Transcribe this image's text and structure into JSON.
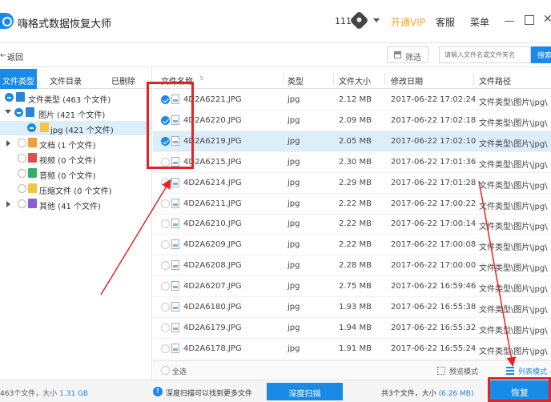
{
  "app": {
    "title": "嗨格式数据恢复大师",
    "user_number": "111"
  },
  "header": {
    "vip_label": "开通VIP",
    "service_label": "客服",
    "menu_label": "菜单",
    "close_glyph": "✕"
  },
  "toolbar": {
    "back_glyph": "←",
    "back_label": "返回",
    "filter_label": "筛选",
    "search_placeholder": "请输入文件名或文件夹名",
    "search_button": "搜索"
  },
  "left_tabs": [
    {
      "label": "文件类型",
      "active": true
    },
    {
      "label": "文件目录",
      "active": false
    },
    {
      "label": "已删除",
      "active": false
    }
  ],
  "tree": [
    {
      "label": "文件类型 (463 个文件)",
      "state": "partial",
      "expander": "none",
      "icon": "folder-icon"
    },
    {
      "label": "图片 (421 个文件)",
      "state": "partial",
      "expander": "down",
      "icon": "image-folder-icon",
      "icon_color": "#2b83da"
    },
    {
      "label": "jpg (421 个文件)",
      "state": "partial",
      "expander": "none",
      "icon": "jpg-folder-icon",
      "icon_color": "#f4c742",
      "selected": true
    },
    {
      "label": "文档 (1 个文件)",
      "state": "none",
      "expander": "right",
      "icon": "document-icon",
      "icon_color": "#f0a030"
    },
    {
      "label": "视频 (0 个文件)",
      "state": "none",
      "expander": "none",
      "icon": "video-icon",
      "icon_color": "#e0504a"
    },
    {
      "label": "音频 (0 个文件)",
      "state": "none",
      "expander": "none",
      "icon": "audio-icon",
      "icon_color": "#2fb06a"
    },
    {
      "label": "压缩文件 (0 个文件)",
      "state": "none",
      "expander": "none",
      "icon": "archive-icon",
      "icon_color": "#f4c742"
    },
    {
      "label": "其他 (41 个文件)",
      "state": "none",
      "expander": "right",
      "icon": "other-icon",
      "icon_color": "#8e5bd6"
    }
  ],
  "table": {
    "headers": {
      "name": "文件名称",
      "type": "类型",
      "size": "文件大小",
      "date": "修改日期",
      "path": "文件路径"
    },
    "rows": [
      {
        "name": "4D2A6221.JPG",
        "type": "jpg",
        "size": "2.12 MB",
        "date": "2017-06-22 17:02:24",
        "path": "文件类型\\图片\\jpg\\",
        "checked": true,
        "selected": false
      },
      {
        "name": "4D2A6220.JPG",
        "type": "jpg",
        "size": "2.09 MB",
        "date": "2017-06-22 17:02:18",
        "path": "文件类型\\图片\\jpg\\",
        "checked": true,
        "selected": false
      },
      {
        "name": "4D2A6219.JPG",
        "type": "jpg",
        "size": "2.05 MB",
        "date": "2017-06-22 17:02:10",
        "path": "文件类型\\图片\\jpg\\",
        "checked": true,
        "selected": true
      },
      {
        "name": "4D2A6215.JPG",
        "type": "jpg",
        "size": "2.30 MB",
        "date": "2017-06-22 17:01:36",
        "path": "文件类型\\图片\\jpg\\",
        "checked": false,
        "selected": false
      },
      {
        "name": "4D2A6214.JPG",
        "type": "jpg",
        "size": "2.29 MB",
        "date": "2017-06-22 17:01:28",
        "path": "文件类型\\图片\\jpg\\",
        "checked": false,
        "selected": false
      },
      {
        "name": "4D2A6211.JPG",
        "type": "jpg",
        "size": "2.22 MB",
        "date": "2017-06-22 17:00:22",
        "path": "文件类型\\图片\\jpg\\",
        "checked": false,
        "selected": false
      },
      {
        "name": "4D2A6210.JPG",
        "type": "jpg",
        "size": "2.22 MB",
        "date": "2017-06-22 17:00:14",
        "path": "文件类型\\图片\\jpg\\",
        "checked": false,
        "selected": false
      },
      {
        "name": "4D2A6209.JPG",
        "type": "jpg",
        "size": "2.22 MB",
        "date": "2017-06-22 17:00:08",
        "path": "文件类型\\图片\\jpg\\",
        "checked": false,
        "selected": false
      },
      {
        "name": "4D2A6208.JPG",
        "type": "jpg",
        "size": "2.28 MB",
        "date": "2017-06-22 17:00:00",
        "path": "文件类型\\图片\\jpg\\",
        "checked": false,
        "selected": false
      },
      {
        "name": "4D2A6207.JPG",
        "type": "jpg",
        "size": "2.75 MB",
        "date": "2017-06-22 16:59:46",
        "path": "文件类型\\图片\\jpg\\",
        "checked": false,
        "selected": false
      },
      {
        "name": "4D2A6180.JPG",
        "type": "jpg",
        "size": "1.93 MB",
        "date": "2017-06-22 16:55:38",
        "path": "文件类型\\图片\\jpg\\",
        "checked": false,
        "selected": false
      },
      {
        "name": "4D2A6179.JPG",
        "type": "jpg",
        "size": "1.94 MB",
        "date": "2017-06-22 16:55:32",
        "path": "文件类型\\图片\\jpg\\",
        "checked": false,
        "selected": false
      },
      {
        "name": "4D2A6178.JPG",
        "type": "jpg",
        "size": "1.91 MB",
        "date": "2017-06-22 16:55:24",
        "path": "文件类型\\图片\\jpg\\",
        "checked": false,
        "selected": false
      }
    ]
  },
  "footer": {
    "select_all": "全选",
    "preview_mode": "预览模式",
    "list_mode": "列表模式"
  },
  "status": {
    "total_prefix": "463个文件，大小",
    "total_size": "1.31 GB",
    "deep_tip": "深度扫描可以找到更多文件",
    "deep_button": "深度扫描",
    "selected_prefix": "共3个文件，大小",
    "selected_size": "(6.26 MB)",
    "recover_button": "恢复"
  },
  "colors": {
    "accent": "#1a8ae8",
    "annotation": "#e32424",
    "vip": "#f5a623"
  }
}
